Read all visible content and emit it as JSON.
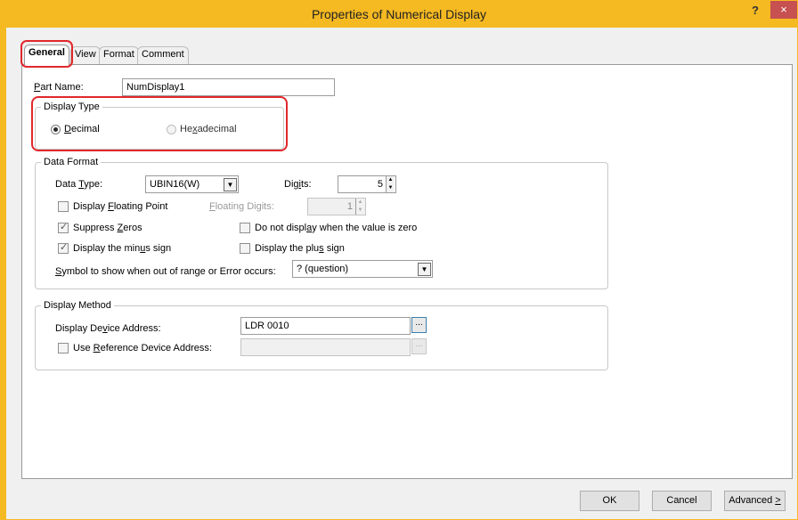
{
  "window": {
    "title": "Properties of Numerical Display",
    "help": "?",
    "close": "×"
  },
  "tabs": [
    {
      "label": "General",
      "active": true
    },
    {
      "label": "View",
      "active": false
    },
    {
      "label": "Format",
      "active": false
    },
    {
      "label": "Comment",
      "active": false
    }
  ],
  "part_name": {
    "label_pre": "",
    "label_u": "P",
    "label_post": "art Name:",
    "value": "NumDisplay1"
  },
  "display_type": {
    "legend": "Display Type",
    "decimal": {
      "u": "D",
      "rest": "ecimal",
      "selected": true
    },
    "hexadecimal": {
      "pre": "He",
      "u": "x",
      "post": "adecimal",
      "selected": false
    }
  },
  "data_format": {
    "legend": "Data Format",
    "data_type": {
      "pre": "Data ",
      "u": "T",
      "post": "ype:",
      "value": "UBIN16(W)"
    },
    "digits": {
      "pre": "Dig",
      "u": "i",
      "post": "ts:",
      "value": "5"
    },
    "display_floating_point": {
      "pre": "Display ",
      "u": "F",
      "post": "loating Point",
      "checked": false
    },
    "floating_digits": {
      "pre": "",
      "u": "F",
      "post": "loating Digits:",
      "value": "1"
    },
    "suppress_zeros": {
      "pre": "Suppress ",
      "u": "Z",
      "post": "eros",
      "checked": true
    },
    "do_not_display_zero": {
      "pre": "Do not displ",
      "u": "a",
      "post": "y when the value is zero",
      "checked": false
    },
    "display_minus": {
      "pre": "Display the min",
      "u": "u",
      "post": "s sign",
      "checked": true
    },
    "display_plus": {
      "pre": "Display the plu",
      "u": "s",
      "post": " sign",
      "checked": false
    },
    "symbol": {
      "pre": "",
      "u": "S",
      "post": "ymbol to show when out of range or Error occurs:",
      "value": "? (question)"
    }
  },
  "display_method": {
    "legend": "Display Method",
    "device_address": {
      "pre": "Display De",
      "u": "v",
      "post": "ice Address:",
      "value": "LDR 0010",
      "browse": "..."
    },
    "reference": {
      "pre": "Use ",
      "u": "R",
      "post": "eference Device Address:",
      "value": "",
      "checked": false,
      "browse": "..."
    }
  },
  "buttons": {
    "ok": "OK",
    "cancel": "Cancel",
    "advanced": {
      "text": "Advanced ",
      "u": ">"
    }
  },
  "colors": {
    "title_bar": "#f5b921",
    "highlight": "#e0282c",
    "close": "#c75050"
  }
}
